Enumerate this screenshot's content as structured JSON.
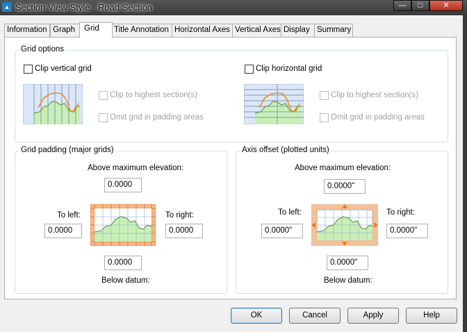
{
  "window": {
    "title": "Section View Style - Road Section",
    "controls": {
      "minimize": "—",
      "maximize": "□",
      "close": "✕"
    }
  },
  "tabs": [
    {
      "label": "Information"
    },
    {
      "label": "Graph"
    },
    {
      "label": "Grid"
    },
    {
      "label": "Title Annotation"
    },
    {
      "label": "Horizontal Axes"
    },
    {
      "label": "Vertical Axes"
    },
    {
      "label": "Display"
    },
    {
      "label": "Summary"
    }
  ],
  "active_tab": "Grid",
  "grid_options": {
    "label": "Grid options",
    "clip_vertical": {
      "label": "Clip vertical grid",
      "checked": false
    },
    "clip_horizontal": {
      "label": "Clip horizontal grid",
      "checked": false
    },
    "left_sub": {
      "clip_highest": "Clip to highest section(s)",
      "omit_padding": "Omit grid in padding areas"
    },
    "right_sub": {
      "clip_highest": "Clip to highest section(s)",
      "omit_padding": "Omit grid in padding areas"
    }
  },
  "grid_padding": {
    "label": "Grid padding (major grids)",
    "above_label": "Above maximum elevation:",
    "above_value": "0.0000",
    "left_label": "To left:",
    "left_value": "0.0000",
    "right_label": "To right:",
    "right_value": "0.0000",
    "below_value": "0.0000",
    "below_label": "Below datum:"
  },
  "axis_offset": {
    "label": "Axis offset (plotted units)",
    "above_label": "Above maximum elevation:",
    "above_value": "0.0000\"",
    "left_label": "To left:",
    "left_value": "0.0000\"",
    "right_label": "To right:",
    "right_value": "0.0000\"",
    "below_value": "0.0000\"",
    "below_label": "Below datum:"
  },
  "buttons": {
    "ok": "OK",
    "cancel": "Cancel",
    "apply": "Apply",
    "help": "Help"
  },
  "colors": {
    "accent": "#1c7fc8",
    "grid_fill": "#c8f0b4",
    "profile": "#f08c1e",
    "padding": "#f7b98a",
    "axis_bg": "#dbe7f6"
  }
}
